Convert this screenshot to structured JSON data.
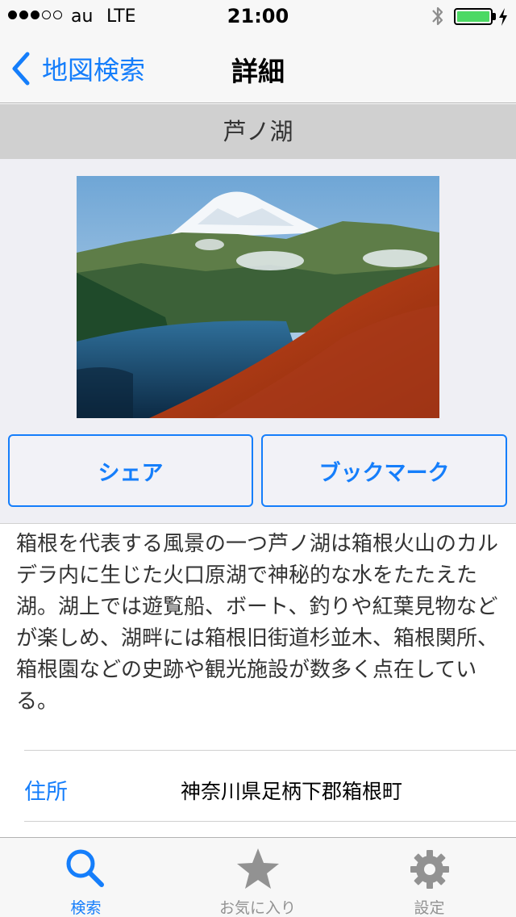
{
  "status_bar": {
    "carrier": "au",
    "network": "LTE",
    "time": "21:00",
    "signal_bars_filled": 3,
    "signal_bars_total": 5,
    "battery_level": 1.0,
    "battery_color": "#4cd964"
  },
  "nav": {
    "back_label": "地図検索",
    "title": "詳細",
    "accent_color": "#157efb"
  },
  "spot": {
    "name": "芦ノ湖",
    "photo_icon": "lake-mountain-photo",
    "share_label": "シェア",
    "bookmark_label": "ブックマーク",
    "description": "箱根を代表する風景の一つ芦ノ湖は箱根火山のカルデラ内に生じた火口原湖で神秘的な水をたたえた湖。湖上では遊覧船、ボート、釣りや紅葉見物などが楽しめ、湖畔には箱根旧街道杉並木、箱根関所、箱根園などの史跡や観光施設が数多く点在している。",
    "address_label": "住所",
    "address_value": "神奈川県足柄下郡箱根町"
  },
  "tabs": [
    {
      "label": "検索",
      "icon": "search-icon",
      "active": true
    },
    {
      "label": "お気に入り",
      "icon": "star-icon",
      "active": false
    },
    {
      "label": "設定",
      "icon": "gear-icon",
      "active": false
    }
  ]
}
